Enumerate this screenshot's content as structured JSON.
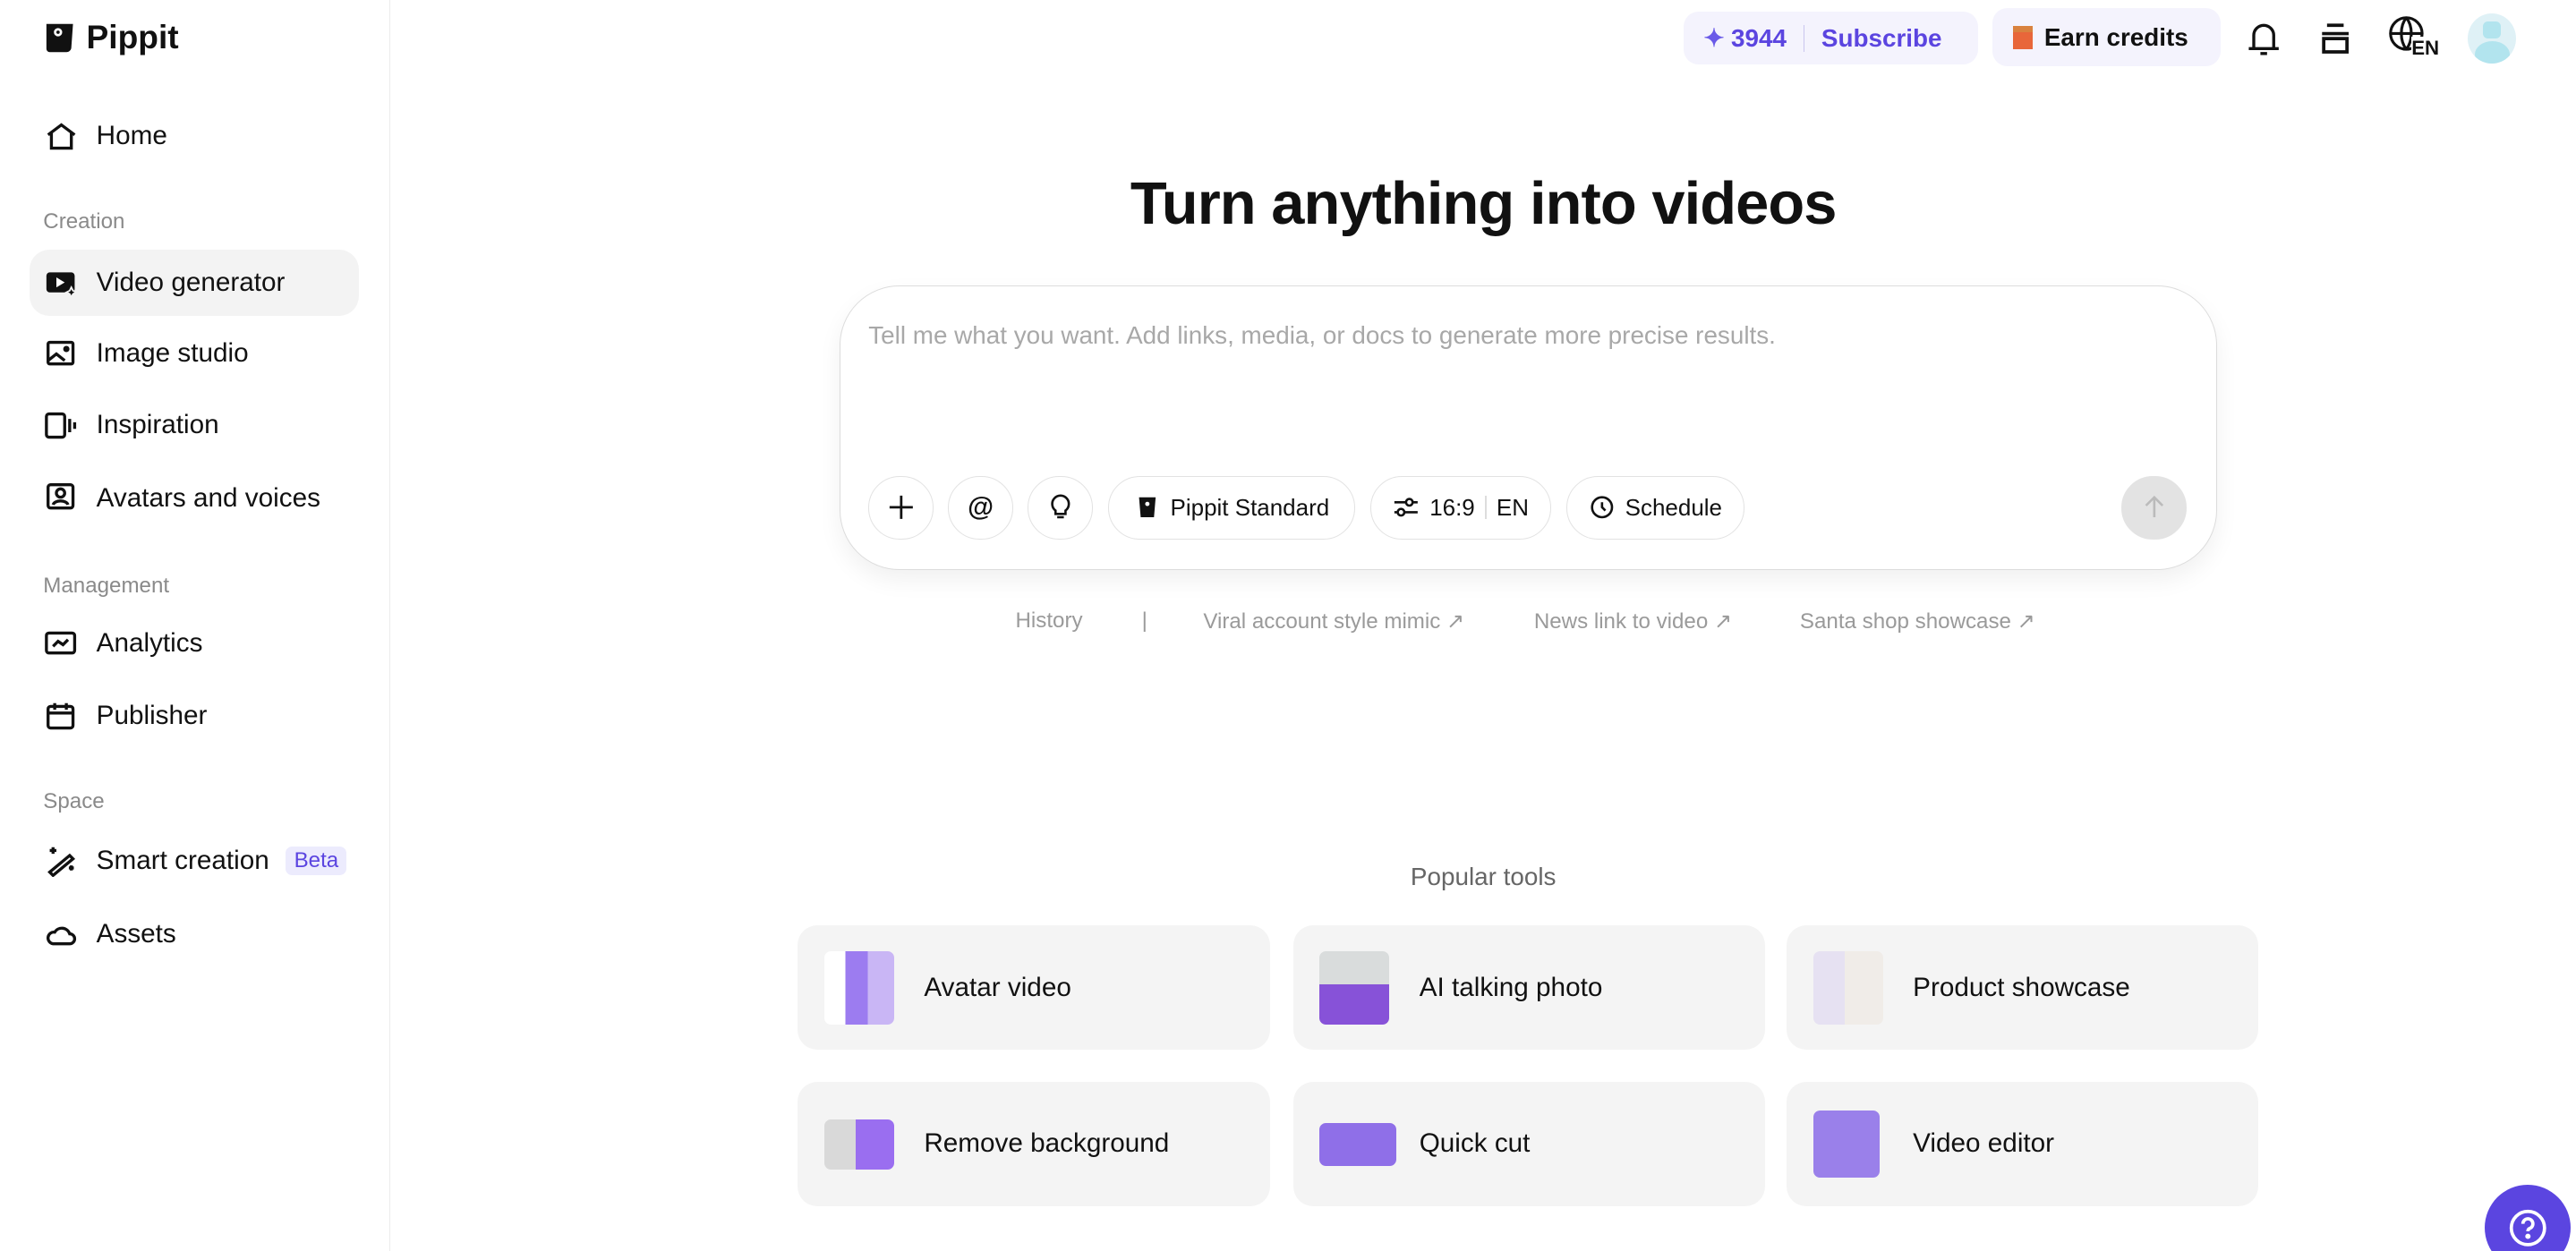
{
  "brand": {
    "name": "Pippit"
  },
  "sidebar": {
    "home": "Home",
    "sections": {
      "creation": "Creation",
      "management": "Management",
      "space": "Space"
    },
    "creation": [
      "Video generator",
      "Image studio",
      "Inspiration",
      "Avatars and voices"
    ],
    "management": [
      "Analytics",
      "Publisher"
    ],
    "space": [
      "Smart creation",
      "Assets"
    ],
    "beta_badge": "Beta"
  },
  "topbar": {
    "credits": "3944",
    "subscribe": "Subscribe",
    "earn": "Earn credits",
    "language": "EN"
  },
  "main": {
    "title": "Turn anything into videos",
    "prompt_placeholder": "Tell me what you want. Add links, media, or docs to generate more precise results.",
    "model": "Pippit Standard",
    "ratio": "16:9",
    "lang": "EN",
    "schedule": "Schedule",
    "links": {
      "history": "History",
      "sep": "|",
      "items": [
        "Viral account style mimic ↗",
        "News link to video ↗",
        "Santa shop showcase ↗"
      ]
    },
    "popular_title": "Popular tools",
    "tools": [
      "Avatar video",
      "AI talking photo",
      "Product showcase",
      "Remove background",
      "Quick cut",
      "Video editor"
    ]
  },
  "colors": {
    "accent": "#5b45e0",
    "active_bg": "#f3f3f3",
    "card_bg": "#f4f4f4"
  }
}
